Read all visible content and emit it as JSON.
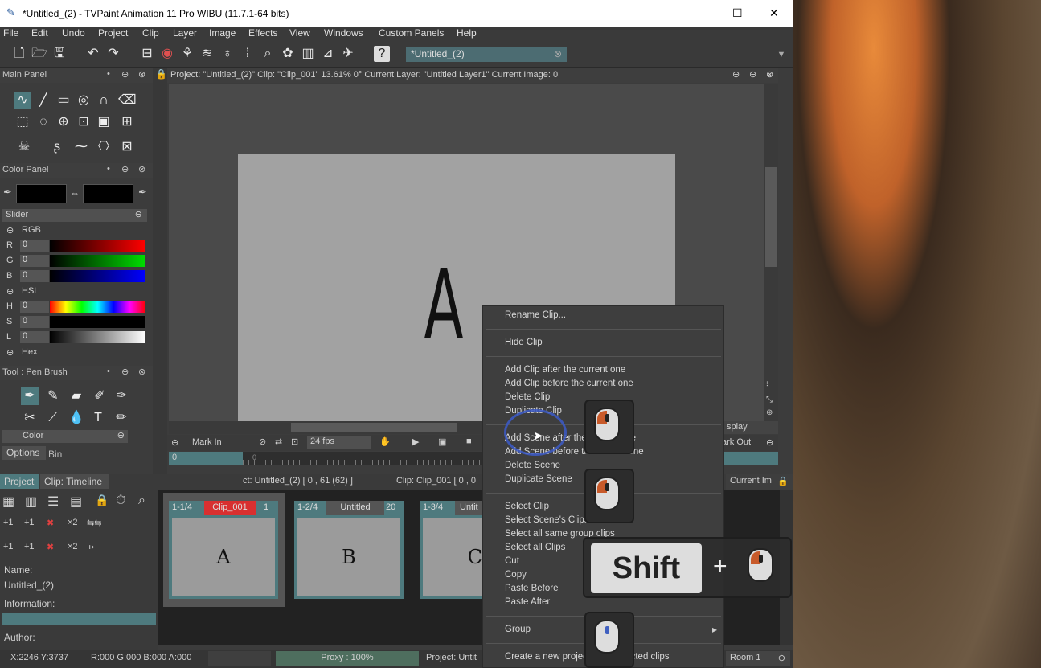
{
  "window": {
    "title": "*Untitled_(2) - TVPaint Animation 11 Pro WIBU (11.7.1-64 bits)",
    "min": "—",
    "max": "☐",
    "close": "✕"
  },
  "menu": [
    "File",
    "Edit",
    "Undo",
    "Project",
    "Clip",
    "Layer",
    "Image",
    "Effects",
    "View",
    "Windows",
    "Custom Panels",
    "Help"
  ],
  "project_tab": {
    "label": "*Untitled_(2)",
    "close": "⊗"
  },
  "main_panel": {
    "title": "Main Panel"
  },
  "viewport": {
    "info": "Project:  \"Untitled_(2)\"  Clip: \"Clip_001\"   13.61%   0°  Current Layer: \"Untitled Layer1\"  Current Image: 0",
    "drawing": "A"
  },
  "color_panel": {
    "title": "Color Panel",
    "slider": "Slider",
    "rgb": "RGB",
    "hsl": "HSL",
    "hex": "Hex",
    "channels": [
      {
        "l": "R",
        "v": "0"
      },
      {
        "l": "G",
        "v": "0"
      },
      {
        "l": "B",
        "v": "0"
      },
      {
        "l": "H",
        "v": "0"
      },
      {
        "l": "S",
        "v": "0"
      },
      {
        "l": "L",
        "v": "0"
      }
    ]
  },
  "tool_panel": {
    "title": "Tool : Pen Brush",
    "color_label": "Color",
    "tabs": [
      "Options",
      "Bin"
    ]
  },
  "playbar": {
    "mark_in": "Mark In",
    "fps": "24 fps",
    "mark_out": "ark Out",
    "display": "splay",
    "frame": "0",
    "frame_mark": "0"
  },
  "project_panel": {
    "tabs": [
      "Project",
      "Clip: Timeline"
    ],
    "name_label": "Name:",
    "name_value": "Untitled_(2)",
    "info_label": "Information:",
    "author_label": "Author:"
  },
  "timeline": {
    "status_left": "ct: Untitled_(2) [ 0 , 61  (62) ]",
    "status_right": "Clip: Clip_001 [ 0 , 0",
    "current_label": "Current Im",
    "clips": [
      {
        "num": "1-1/4",
        "name": "Clip_001",
        "count": "1",
        "thumb": "A"
      },
      {
        "num": "1-2/4",
        "name": "Untitled",
        "count": "20",
        "thumb": "B"
      },
      {
        "num": "1-3/4",
        "name": "Untit",
        "count": "",
        "thumb": "C"
      }
    ]
  },
  "context_menu": {
    "items": [
      "Rename Clip...",
      "Hide Clip",
      "Add Clip after the current one",
      "Add Clip before the current one",
      "Delete Clip",
      "Duplicate Clip",
      "Add Scene after the current one",
      "Add Scene before the current one",
      "Delete Scene",
      "Duplicate Scene",
      "Select Clip",
      "Select Scene's Clips",
      "Select all same group clips",
      "Select all Clips",
      "Cut",
      "Copy",
      "Paste Before",
      "Paste After",
      "Group",
      "Create a new project from selected clips"
    ],
    "submenu_arrow": "▸"
  },
  "overlay": {
    "key": "Shift",
    "plus": "+"
  },
  "statusbar": {
    "coords": "X:2246  Y:3737",
    "rgba": "R:000 G:000 B:000 A:000",
    "proxy": "Proxy : 100%",
    "project": "Project: Untit",
    "room": "Room 1"
  },
  "colors": {
    "accent_red": "#d83030",
    "teal": "#4e7a7e",
    "menu_bg": "#3e3e3e"
  }
}
